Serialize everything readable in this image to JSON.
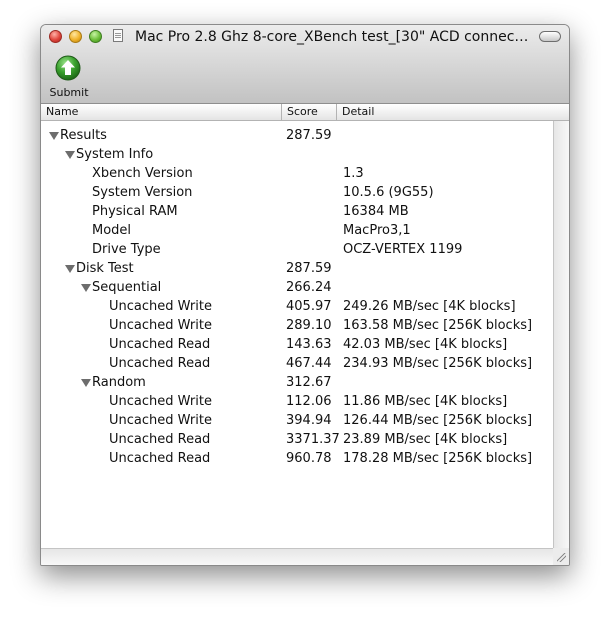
{
  "window": {
    "title": "Mac Pro 2.8 Ghz 8-core_XBench test_[30\" ACD connected to..."
  },
  "toolbar": {
    "submit_label": "Submit",
    "submit_icon": "up-arrow-icon",
    "accent": "#3aa12e"
  },
  "columns": {
    "name": "Name",
    "score": "Score",
    "detail": "Detail"
  },
  "rows": [
    {
      "name": "Results",
      "score": "287.59",
      "detail": "",
      "level": 0,
      "expandable": true
    },
    {
      "name": "System Info",
      "score": "",
      "detail": "",
      "level": 1,
      "expandable": true
    },
    {
      "name": "Xbench Version",
      "score": "",
      "detail": "1.3",
      "level": 2,
      "expandable": false
    },
    {
      "name": "System Version",
      "score": "",
      "detail": "10.5.6 (9G55)",
      "level": 2,
      "expandable": false
    },
    {
      "name": "Physical RAM",
      "score": "",
      "detail": "16384 MB",
      "level": 2,
      "expandable": false
    },
    {
      "name": "Model",
      "score": "",
      "detail": "MacPro3,1",
      "level": 2,
      "expandable": false
    },
    {
      "name": "Drive Type",
      "score": "",
      "detail": "OCZ-VERTEX 1199",
      "level": 2,
      "expandable": false
    },
    {
      "name": "Disk Test",
      "score": "287.59",
      "detail": "",
      "level": 1,
      "expandable": true
    },
    {
      "name": "Sequential",
      "score": "266.24",
      "detail": "",
      "level": 2,
      "expandable": true
    },
    {
      "name": "Uncached Write",
      "score": "405.97",
      "detail": "249.26 MB/sec [4K blocks]",
      "level": 3,
      "expandable": false
    },
    {
      "name": "Uncached Write",
      "score": "289.10",
      "detail": "163.58 MB/sec [256K blocks]",
      "level": 3,
      "expandable": false
    },
    {
      "name": "Uncached Read",
      "score": "143.63",
      "detail": "42.03 MB/sec [4K blocks]",
      "level": 3,
      "expandable": false
    },
    {
      "name": "Uncached Read",
      "score": "467.44",
      "detail": "234.93 MB/sec [256K blocks]",
      "level": 3,
      "expandable": false
    },
    {
      "name": "Random",
      "score": "312.67",
      "detail": "",
      "level": 2,
      "expandable": true
    },
    {
      "name": "Uncached Write",
      "score": "112.06",
      "detail": "11.86 MB/sec [4K blocks]",
      "level": 3,
      "expandable": false
    },
    {
      "name": "Uncached Write",
      "score": "394.94",
      "detail": "126.44 MB/sec [256K blocks]",
      "level": 3,
      "expandable": false
    },
    {
      "name": "Uncached Read",
      "score": "3371.37",
      "detail": "23.89 MB/sec [4K blocks]",
      "level": 3,
      "expandable": false
    },
    {
      "name": "Uncached Read",
      "score": "960.78",
      "detail": "178.28 MB/sec [256K blocks]",
      "level": 3,
      "expandable": false
    }
  ]
}
